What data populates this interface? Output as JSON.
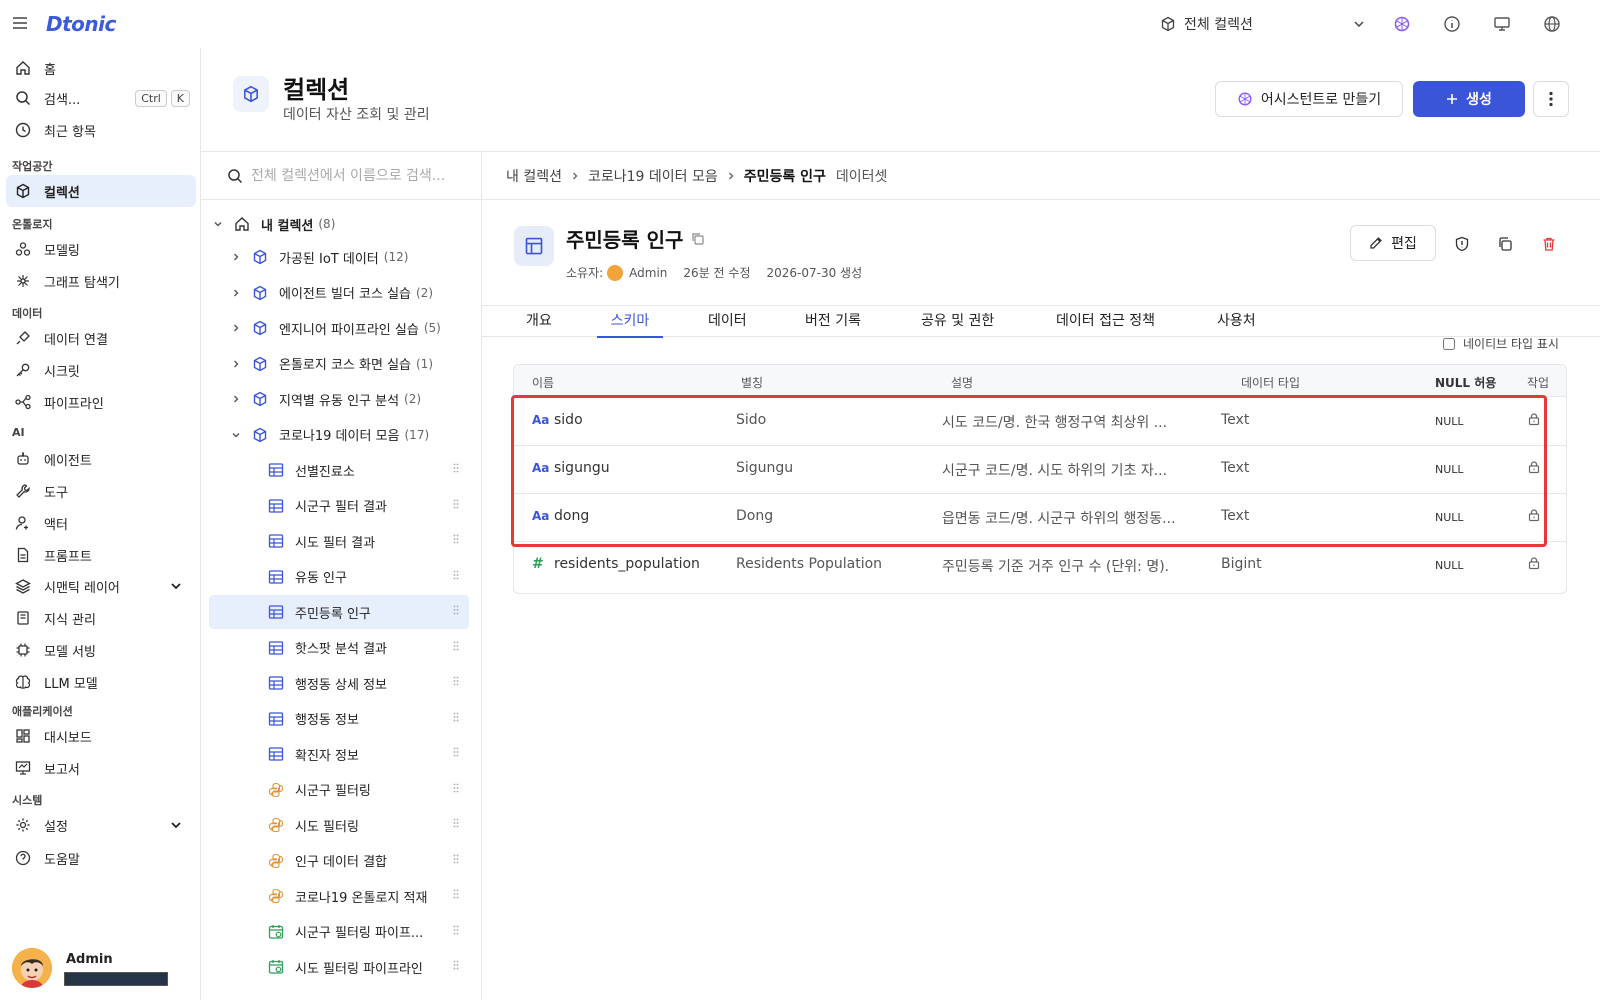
{
  "app": {
    "logo": "Dtonic",
    "collection_selector": "전체 컬렉션"
  },
  "nav": {
    "home": "홈",
    "search": "검색...",
    "search_kbd": [
      "Ctrl",
      "K"
    ],
    "recent": "최근 항목",
    "sections": {
      "workspace": "작업공간",
      "ontology": "온톨로지",
      "data": "데이터",
      "ai": "AI",
      "apps": "애플리케이션",
      "system": "시스템"
    },
    "items": {
      "collections": "컬렉션",
      "modeling": "모델링",
      "graph_explorer": "그래프 탐색기",
      "data_connection": "데이터 연결",
      "secrets": "시크릿",
      "pipeline": "파이프라인",
      "agent": "에이전트",
      "tools": "도구",
      "actor": "액터",
      "prompt": "프롬프트",
      "semantic_layer": "시맨틱 레이어",
      "knowledge": "지식 관리",
      "model_serving": "모델 서빙",
      "llm_model": "LLM 모델",
      "dashboard": "대시보드",
      "reports": "보고서",
      "settings": "설정",
      "help": "도움말"
    },
    "user": "Admin"
  },
  "page": {
    "title": "컬렉션",
    "subtitle": "데이터 자산 조회 및 관리",
    "assist_button": "어시스턴트로 만들기",
    "create_button": "생성"
  },
  "tree": {
    "search_placeholder": "전체 컬렉션에서 이름으로 검색...",
    "root": {
      "label": "내 컬렉션",
      "count": "(8)"
    },
    "folders": [
      {
        "label": "가공된 IoT 데이터",
        "count": "(12)"
      },
      {
        "label": "에이전트 빌더 코스 실습",
        "count": "(2)"
      },
      {
        "label": "엔지니어 파이프라인 실습",
        "count": "(5)"
      },
      {
        "label": "온톨로지 코스 화면 실습",
        "count": "(1)"
      },
      {
        "label": "지역별 유동 인구 분석",
        "count": "(2)"
      },
      {
        "label": "코로나19 데이터 모음",
        "count": "(17)"
      }
    ],
    "children": [
      {
        "label": "선별진료소",
        "kind": "table"
      },
      {
        "label": "시군구 필터 결과",
        "kind": "table"
      },
      {
        "label": "시도 필터 결과",
        "kind": "table"
      },
      {
        "label": "유동 인구",
        "kind": "table"
      },
      {
        "label": "주민등록 인구",
        "kind": "table"
      },
      {
        "label": "핫스팟 분석 결과",
        "kind": "table"
      },
      {
        "label": "행정동 상세 정보",
        "kind": "table"
      },
      {
        "label": "행정동 정보",
        "kind": "table"
      },
      {
        "label": "확진자 정보",
        "kind": "table"
      },
      {
        "label": "시군구 필터링",
        "kind": "python"
      },
      {
        "label": "시도 필터링",
        "kind": "python"
      },
      {
        "label": "인구 데이터 결합",
        "kind": "python"
      },
      {
        "label": "코로나19 온톨로지 적재",
        "kind": "python"
      },
      {
        "label": "시군구 필터링 파이프...",
        "kind": "pipeline"
      },
      {
        "label": "시도 필터링 파이프라인",
        "kind": "pipeline"
      }
    ]
  },
  "breadcrumb": {
    "items": [
      "내 컬렉션",
      "코로나19 데이터 모음",
      "주민등록 인구"
    ],
    "type": "데이터셋"
  },
  "dataset": {
    "title": "주민등록 인구",
    "owner_label": "소유자:",
    "owner": "Admin",
    "modified": "26분 전 수정",
    "created": "2026-07-30 생성",
    "edit_button": "편집"
  },
  "tabs": [
    "개요",
    "스키마",
    "데이터",
    "버전 기록",
    "공유 및 권한",
    "데이터 접근 정책",
    "사용처"
  ],
  "schema": {
    "native_type_toggle": "네이티브 타입 표시",
    "headers": {
      "name": "이름",
      "alias": "별칭",
      "desc": "설명",
      "type": "데이터 타입",
      "null": "NULL 허용",
      "action": "작업"
    },
    "rows": [
      {
        "icon": "Aa",
        "name": "sido",
        "alias": "Sido",
        "desc": "시도 코드/명. 한국 행정구역 최상위 ...",
        "type": "Text",
        "null": "NULL"
      },
      {
        "icon": "Aa",
        "name": "sigungu",
        "alias": "Sigungu",
        "desc": "시군구 코드/명. 시도 하위의 기초 자...",
        "type": "Text",
        "null": "NULL"
      },
      {
        "icon": "Aa",
        "name": "dong",
        "alias": "Dong",
        "desc": "읍면동 코드/명. 시군구 하위의 행정동...",
        "type": "Text",
        "null": "NULL"
      },
      {
        "icon": "#",
        "name": "residents_population",
        "alias": "Residents Population",
        "desc": "주민등록 기준 거주 인구 수 (단위: 명).",
        "type": "Bigint",
        "null": "NULL"
      }
    ]
  },
  "colors": {
    "accent": "#3b55d8",
    "active_bg": "#e8effc",
    "highlight": "#e53935",
    "python_icon": "#e0913a",
    "pipeline_icon": "#2e9e5b"
  }
}
